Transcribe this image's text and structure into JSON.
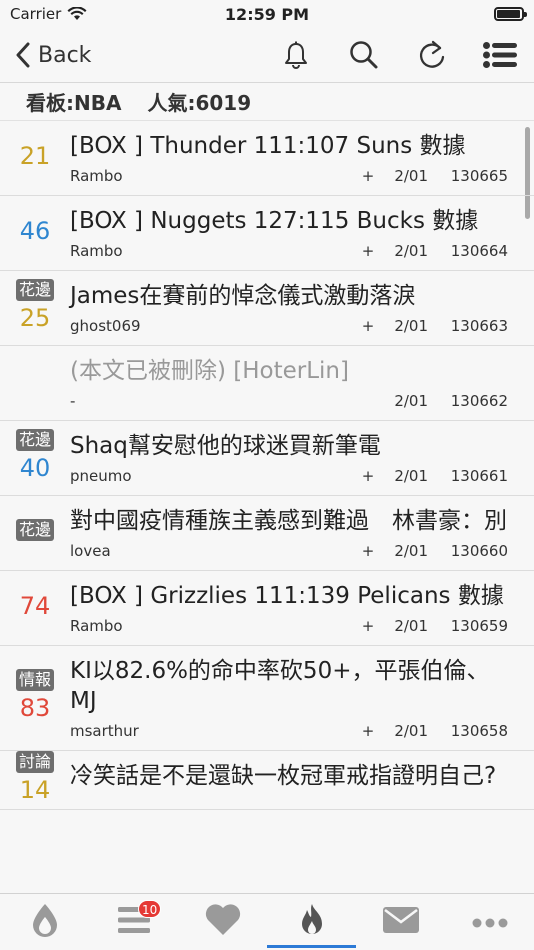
{
  "status": {
    "carrier": "Carrier",
    "time": "12:59 PM",
    "battery_level": 0.95
  },
  "nav": {
    "back_label": "Back"
  },
  "board": {
    "name": "看板:NBA",
    "popularity": "人氣:6019"
  },
  "colors": {
    "gold": "#c9a227",
    "blue": "#2f86d0",
    "red": "#e0483a",
    "accent": "#2c7ad6"
  },
  "posts": [
    {
      "tag": "",
      "score": "21",
      "score_color": "#c9a227",
      "title": "[BOX ] Thunder 111:107 Suns 數據",
      "author": "Rambo",
      "plus": "+",
      "date": "2/01",
      "num": "130665"
    },
    {
      "tag": "",
      "score": "46",
      "score_color": "#2f86d0",
      "title": "[BOX ] Nuggets 127:115 Bucks 數據",
      "author": "Rambo",
      "plus": "+",
      "date": "2/01",
      "num": "130664"
    },
    {
      "tag": "花邊",
      "score": "25",
      "score_color": "#c9a227",
      "title": "James在賽前的悼念儀式激動落淚",
      "author": "ghost069",
      "plus": "+",
      "date": "2/01",
      "num": "130663"
    },
    {
      "tag": "",
      "score": "",
      "score_color": "#999",
      "title": "(本文已被刪除) [HoterLin]",
      "author": "-",
      "plus": "",
      "date": "2/01",
      "num": "130662",
      "deleted": true
    },
    {
      "tag": "花邊",
      "score": "40",
      "score_color": "#2f86d0",
      "title": "Shaq幫安慰他的球迷買新筆電",
      "author": "pneumo",
      "plus": "+",
      "date": "2/01",
      "num": "130661"
    },
    {
      "tag": "花邊",
      "score": "",
      "score_color": "#999",
      "title": "對中國疫情種族主義感到難過　林書豪：別",
      "author": "lovea",
      "plus": "+",
      "date": "2/01",
      "num": "130660"
    },
    {
      "tag": "",
      "score": "74",
      "score_color": "#e0483a",
      "title": "[BOX ] Grizzlies 111:139 Pelicans 數據",
      "author": "Rambo",
      "plus": "+",
      "date": "2/01",
      "num": "130659"
    },
    {
      "tag": "情報",
      "score": "83",
      "score_color": "#e0483a",
      "title": "KI以82.6%的命中率砍50+，平張伯倫、MJ",
      "author": "msarthur",
      "plus": "+",
      "date": "2/01",
      "num": "130658"
    },
    {
      "tag": "討論",
      "score": "14",
      "score_color": "#c9a227",
      "title": "冷笑話是不是還缺一枚冠軍戒指證明自己?",
      "author": "",
      "plus": "",
      "date": "",
      "num": ""
    }
  ],
  "tabs": [
    {
      "name": "hot-boards",
      "icon": "fire-drop-icon",
      "badge": ""
    },
    {
      "name": "boards",
      "icon": "list-icon",
      "badge": "10"
    },
    {
      "name": "favorites",
      "icon": "heart-icon",
      "badge": ""
    },
    {
      "name": "hot-posts",
      "icon": "flame-icon",
      "badge": "",
      "active": true
    },
    {
      "name": "mail",
      "icon": "mail-icon",
      "badge": ""
    },
    {
      "name": "more",
      "icon": "more-icon",
      "badge": ""
    }
  ]
}
